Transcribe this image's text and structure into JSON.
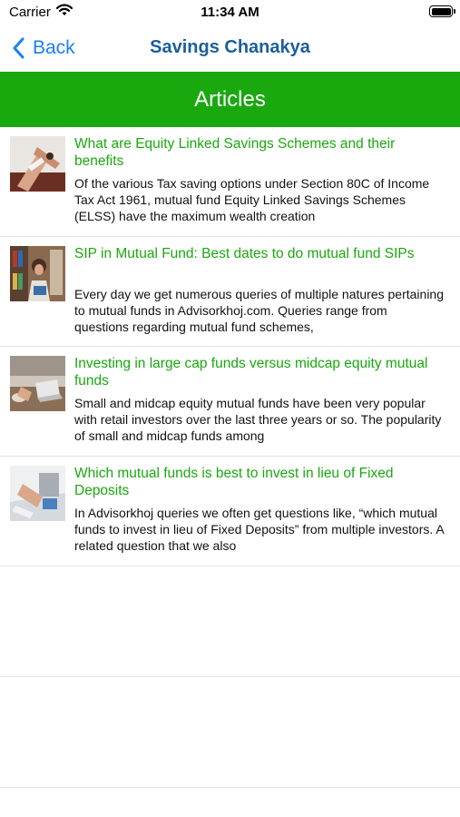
{
  "status_bar": {
    "carrier": "Carrier",
    "time": "11:34 AM"
  },
  "nav": {
    "back_label": "Back",
    "title": "Savings Chanakya"
  },
  "section": {
    "title": "Articles"
  },
  "articles": [
    {
      "title": "What are Equity Linked Savings Schemes and their benefits",
      "description": "Of the various Tax saving options under Section 80C of Income Tax Act 1961, mutual fund Equity Linked Savings Schemes (ELSS) have the maximum wealth creation"
    },
    {
      "title": "SIP in Mutual Fund: Best dates to do mutual fund SIPs",
      "description": "Every day we get numerous queries of multiple natures pertaining to mutual funds in Advisorkhoj.com. Queries range from questions regarding mutual fund schemes,"
    },
    {
      "title": "Investing in large cap funds versus midcap equity mutual funds",
      "description": "Small and midcap equity mutual funds have been very popular with retail investors over the last three years or so. The popularity of small and midcap funds among"
    },
    {
      "title": "Which mutual funds is best to invest in lieu of Fixed Deposits",
      "description": "In Advisorkhoj queries we often get questions like, “which mutual funds to invest in lieu of Fixed Deposits” from multiple investors. A related question that we also"
    }
  ],
  "colors": {
    "accent_green": "#1aa80f",
    "nav_title": "#1b5f9a",
    "back_blue": "#1b7ef7"
  }
}
